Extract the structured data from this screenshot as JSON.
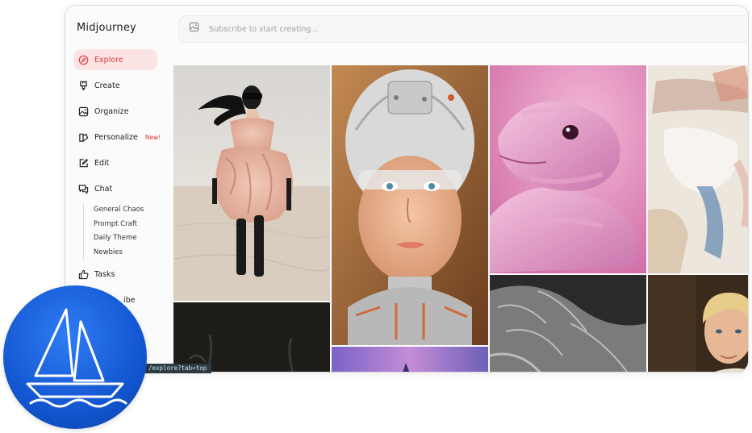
{
  "brand": {
    "name": "Midjourney"
  },
  "search": {
    "placeholder": "Subscribe to start creating..."
  },
  "sidebar": {
    "items": [
      {
        "label": "Explore",
        "icon": "compass-icon",
        "active": true
      },
      {
        "label": "Create",
        "icon": "brush-icon"
      },
      {
        "label": "Organize",
        "icon": "image-icon"
      },
      {
        "label": "Personalize",
        "icon": "personalize-icon",
        "badge": "New!"
      },
      {
        "label": "Edit",
        "icon": "edit-icon"
      },
      {
        "label": "Chat",
        "icon": "chat-icon"
      },
      {
        "label": "Tasks",
        "icon": "thumbs-up-icon"
      },
      {
        "label": "ibe",
        "icon": ""
      }
    ],
    "chat_rooms": [
      "General Chaos",
      "Prompt Craft",
      "Daily Theme",
      "Newbies"
    ]
  },
  "status_bar": {
    "url": "/explore?tab=top"
  },
  "colors": {
    "accent": "#e03b3b",
    "accent_bg": "#fde4e4",
    "logo_blue": "#1357d1"
  }
}
